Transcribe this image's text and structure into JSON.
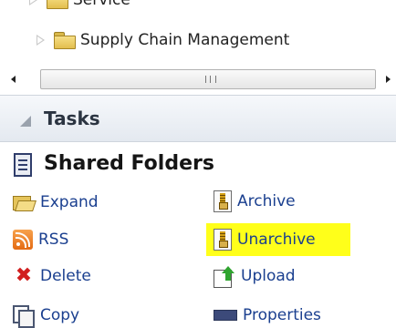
{
  "tree": {
    "items": [
      {
        "label": "Service"
      },
      {
        "label": "Supply Chain Management"
      }
    ]
  },
  "scrollbar": {
    "grip_glyph": "III"
  },
  "tasks_panel": {
    "title": "Tasks"
  },
  "shared_folders": {
    "title": "Shared Folders",
    "actions": {
      "expand": "Expand",
      "archive": "Archive",
      "rss": "RSS",
      "unarchive": "Unarchive",
      "delete": "Delete",
      "upload": "Upload",
      "copy": "Copy",
      "properties": "Properties"
    }
  },
  "colors": {
    "highlight": "#ffff1a",
    "link": "#1a3f8f"
  }
}
